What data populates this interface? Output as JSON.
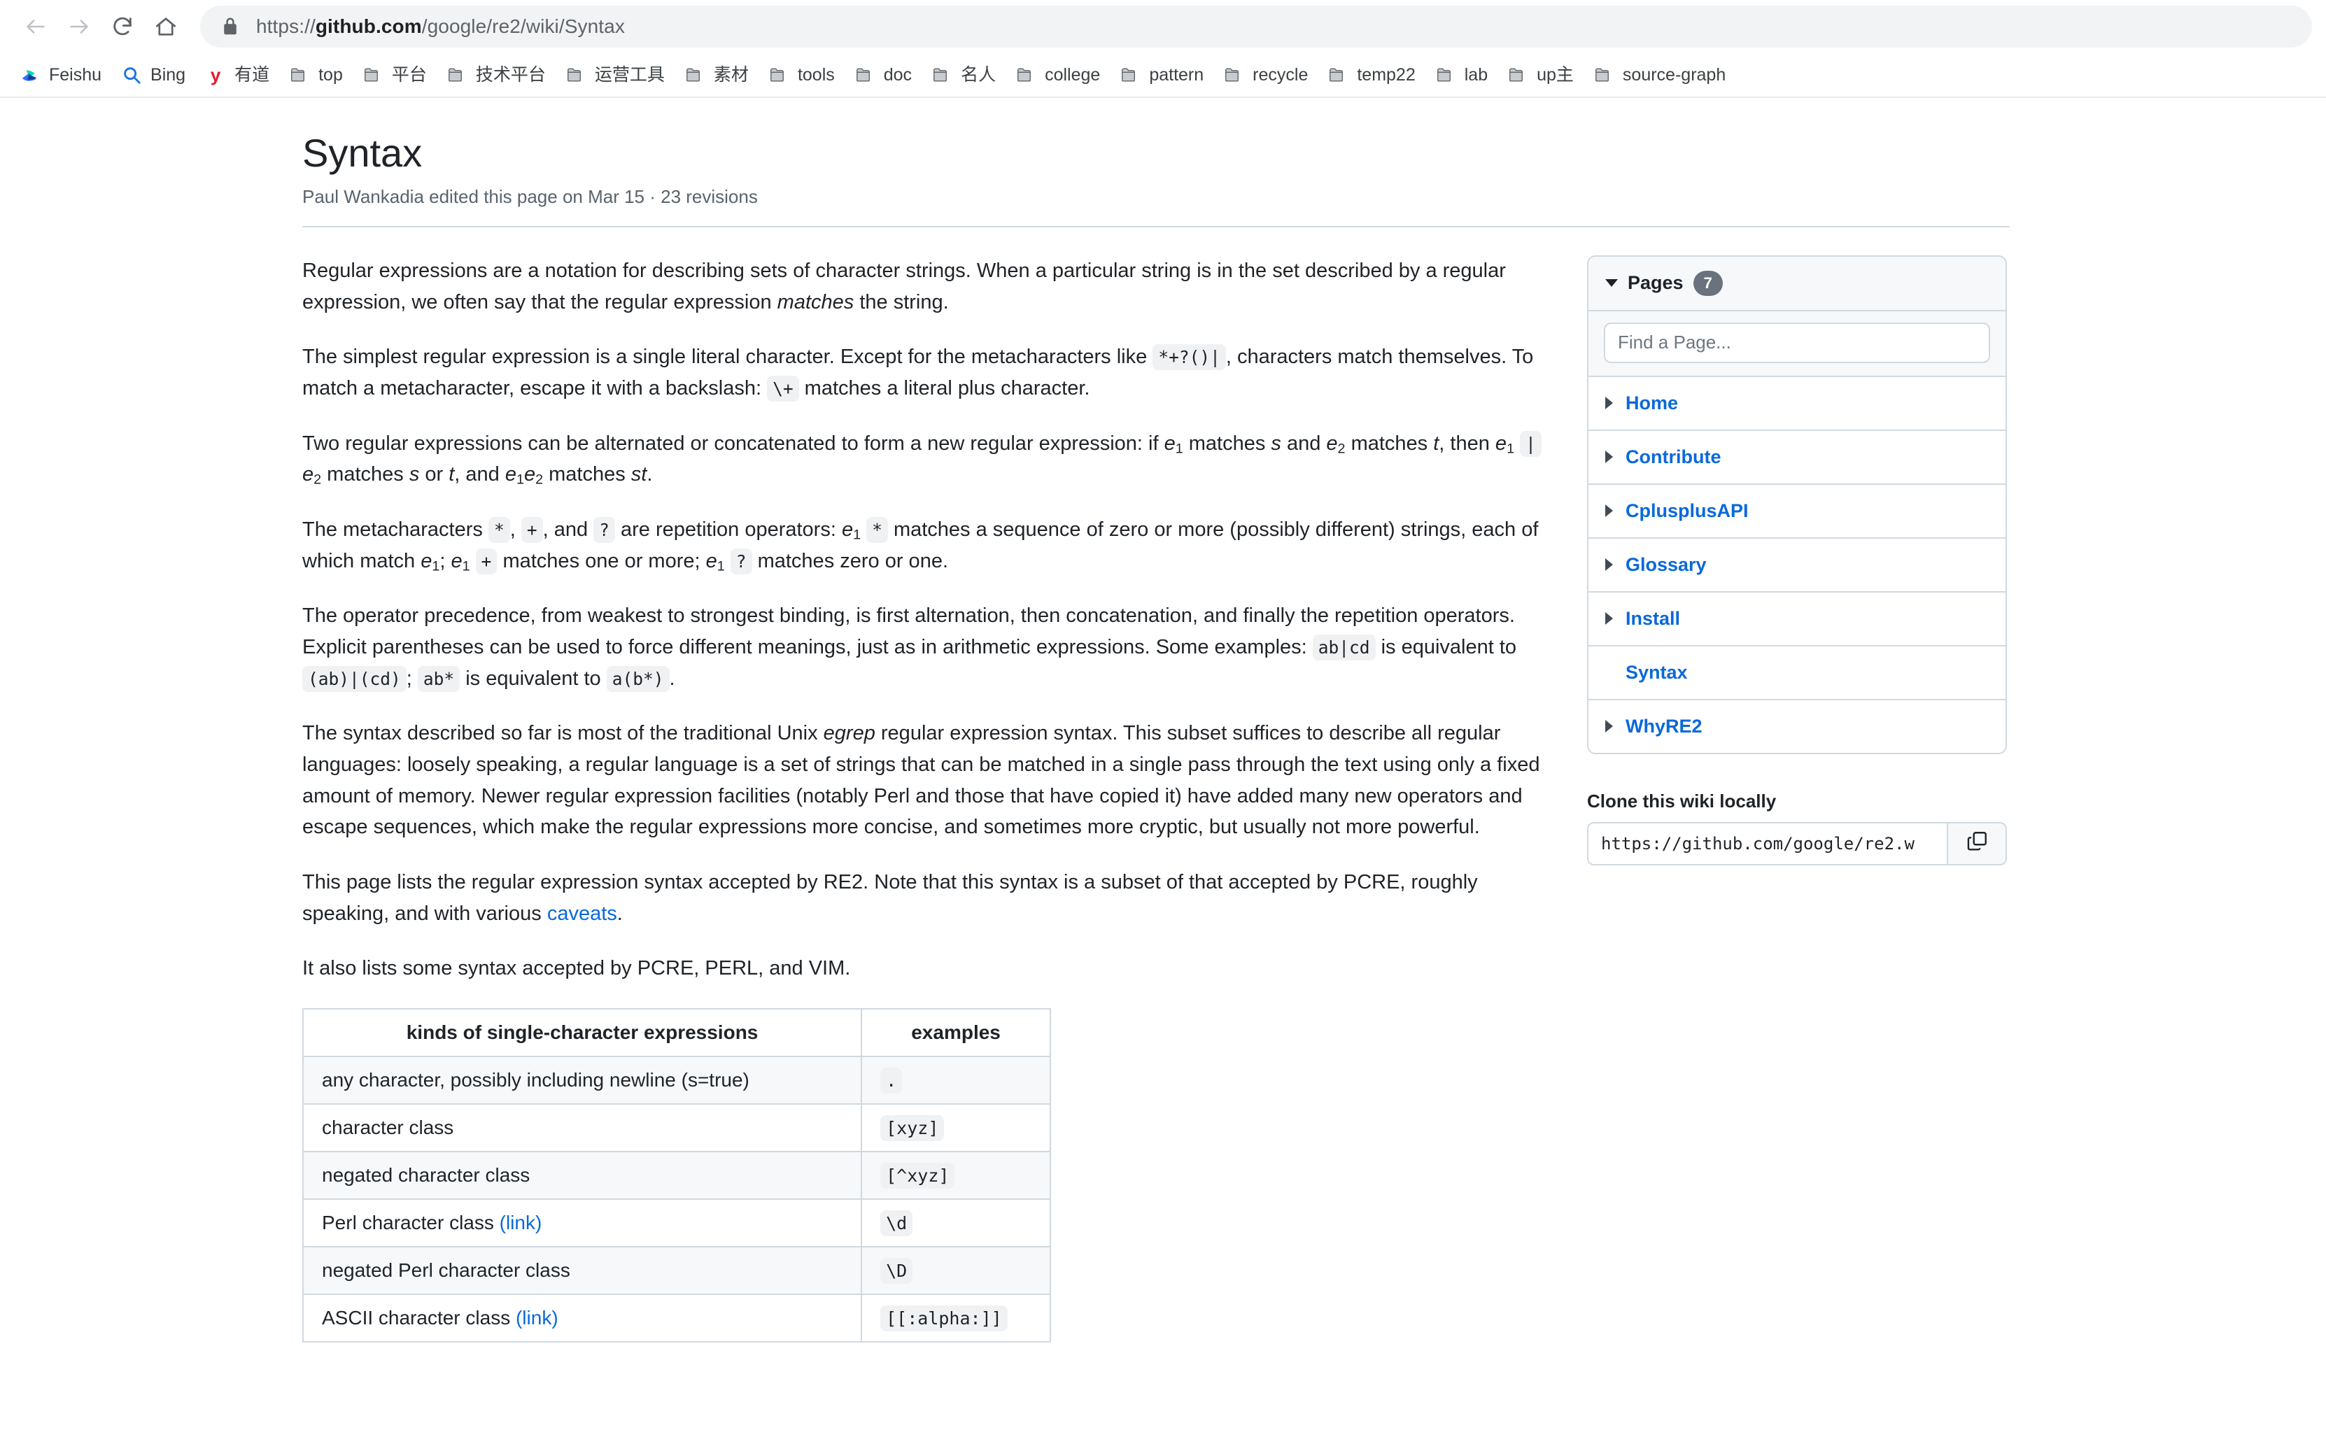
{
  "browser": {
    "nav": {
      "back_label": "Back",
      "forward_label": "Forward",
      "reload_label": "Reload",
      "home_label": "Home"
    },
    "omnibox": {
      "scheme": "https://",
      "host": "github.com",
      "path": "/google/re2/wiki/Syntax",
      "full_url": "https://github.com/google/re2/wiki/Syntax"
    },
    "bookmarks": [
      {
        "label": "Feishu",
        "icon": "feishu-icon"
      },
      {
        "label": "Bing",
        "icon": "search-icon"
      },
      {
        "label": "有道",
        "icon": "youdao-icon"
      },
      {
        "label": "top",
        "icon": "folder-icon"
      },
      {
        "label": "平台",
        "icon": "folder-icon"
      },
      {
        "label": "技术平台",
        "icon": "folder-icon"
      },
      {
        "label": "运营工具",
        "icon": "folder-icon"
      },
      {
        "label": "素材",
        "icon": "folder-icon"
      },
      {
        "label": "tools",
        "icon": "folder-icon"
      },
      {
        "label": "doc",
        "icon": "folder-icon"
      },
      {
        "label": "名人",
        "icon": "folder-icon"
      },
      {
        "label": "college",
        "icon": "folder-icon"
      },
      {
        "label": "pattern",
        "icon": "folder-icon"
      },
      {
        "label": "recycle",
        "icon": "folder-icon"
      },
      {
        "label": "temp22",
        "icon": "folder-icon"
      },
      {
        "label": "lab",
        "icon": "folder-icon"
      },
      {
        "label": "up主",
        "icon": "folder-icon"
      },
      {
        "label": "source-graph",
        "icon": "folder-icon"
      }
    ]
  },
  "wiki": {
    "title": "Syntax",
    "subtitle": "Paul Wankadia edited this page on Mar 15 · 23 revisions"
  },
  "content": {
    "p1_a": "Regular expressions are a notation for describing sets of character strings. When a particular string is in the set described by a regular expression, we often say that the regular expression ",
    "p1_em": "matches",
    "p1_b": " the string.",
    "p2_a": "The simplest regular expression is a single literal character. Except for the metacharacters like ",
    "p2_code1": "*+?()|",
    "p2_b": ", characters match themselves. To match a metacharacter, escape it with a backslash: ",
    "p2_code2": "\\+",
    "p2_c": " matches a literal plus character.",
    "p3_a": "Two regular expressions can be alternated or concatenated to form a new regular expression: if ",
    "p3_e1": "e",
    "p3_sub1": "1",
    "p3_b": " matches ",
    "p3_s": "s",
    "p3_c": " and ",
    "p3_e2": "e",
    "p3_sub2": "2",
    "p3_d": " matches ",
    "p3_t": "t",
    "p3_e": ", then ",
    "p3_code": "|",
    "p3_f": " matches ",
    "p3_g": " or ",
    "p3_h": ", and ",
    "p3_i": " matches ",
    "p3_st": "st",
    "p3_j": ".",
    "p4_a": "The metacharacters ",
    "p4_star": "*",
    "p4_b": ", ",
    "p4_plus": "+",
    "p4_c": ", and ",
    "p4_q": "?",
    "p4_d": " are repetition operators: ",
    "p4_e": " matches a sequence of zero or more (possibly different) strings, each of which match ",
    "p4_f": "; ",
    "p4_g": " matches one or more; ",
    "p4_h": " matches zero or one.",
    "p5_a": "The operator precedence, from weakest to strongest binding, is first alternation, then concatenation, and finally the repetition operators. Explicit parentheses can be used to force different meanings, just as in arithmetic expressions. Some examples: ",
    "p5_code1": "ab|cd",
    "p5_b": " is equivalent to ",
    "p5_code2": "(ab)|(cd)",
    "p5_c": "; ",
    "p5_code3": "ab*",
    "p5_d": " is equivalent to ",
    "p5_code4": "a(b*)",
    "p5_e": ".",
    "p6_a": "The syntax described so far is most of the traditional Unix ",
    "p6_em": "egrep",
    "p6_b": " regular expression syntax. This subset suffices to describe all regular languages: loosely speaking, a regular language is a set of strings that can be matched in a single pass through the text using only a fixed amount of memory. Newer regular expression facilities (notably Perl and those that have copied it) have added many new operators and escape sequences, which make the regular expressions more concise, and sometimes more cryptic, but usually not more powerful.",
    "p7_a": "This page lists the regular expression syntax accepted by RE2. Note that this syntax is a subset of that accepted by PCRE, roughly speaking, and with various ",
    "p7_link": "caveats",
    "p7_b": ".",
    "p8": "It also lists some syntax accepted by PCRE, PERL, and VIM."
  },
  "table": {
    "headers": [
      "kinds of single-character expressions",
      "examples"
    ],
    "rows": [
      {
        "kind": "any character, possibly including newline (s=true)",
        "link": "",
        "example": "."
      },
      {
        "kind": "character class",
        "link": "",
        "example": "[xyz]"
      },
      {
        "kind": "negated character class",
        "link": "",
        "example": "[^xyz]"
      },
      {
        "kind": "Perl character class ",
        "link": "(link)",
        "example": "\\d"
      },
      {
        "kind": "negated Perl character class",
        "link": "",
        "example": "\\D"
      },
      {
        "kind": "ASCII character class ",
        "link": "(link)",
        "example": "[[:alpha:]]"
      }
    ]
  },
  "sidebar": {
    "pages_title": "Pages",
    "pages_count": "7",
    "search_placeholder": "Find a Page...",
    "pages": [
      {
        "label": "Home",
        "expandable": true,
        "current": false
      },
      {
        "label": "Contribute",
        "expandable": true,
        "current": false
      },
      {
        "label": "CplusplusAPI",
        "expandable": true,
        "current": false
      },
      {
        "label": "Glossary",
        "expandable": true,
        "current": false
      },
      {
        "label": "Install",
        "expandable": true,
        "current": false
      },
      {
        "label": "Syntax",
        "expandable": false,
        "current": true
      },
      {
        "label": "WhyRE2",
        "expandable": true,
        "current": false
      }
    ],
    "clone_title": "Clone this wiki locally",
    "clone_url": "https://github.com/google/re2.w",
    "copy_label": "Copy to clipboard"
  },
  "colors": {
    "link": "#0969da",
    "border": "#d1d9e0",
    "muted": "#59636e",
    "text": "#1f2328",
    "header_bg": "#f6f8fa",
    "code_bg": "#eff1f3"
  }
}
